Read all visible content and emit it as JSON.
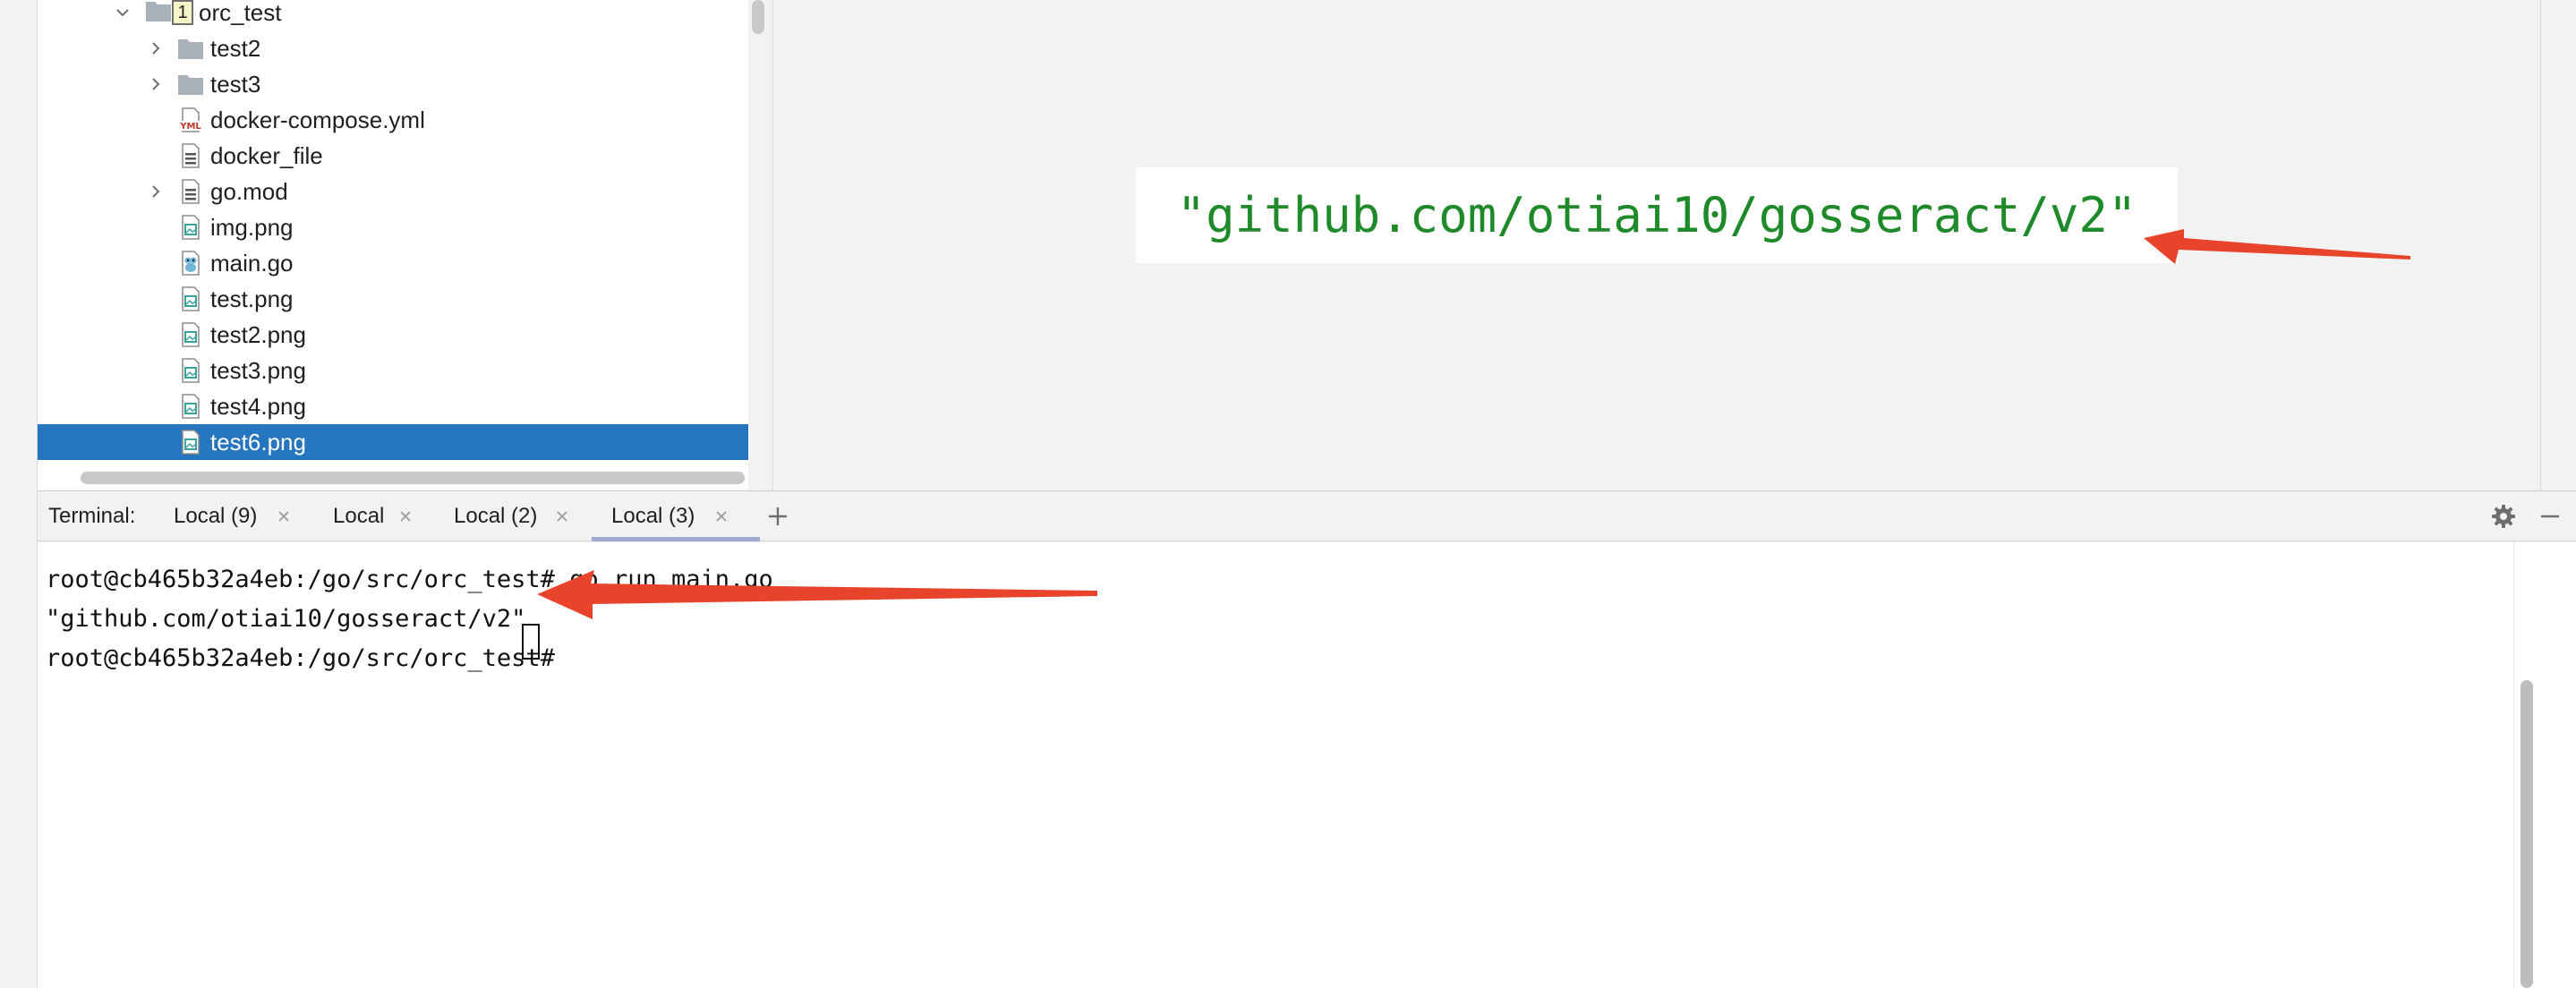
{
  "project_tree": {
    "root": {
      "label": "orc_test",
      "badge": "1"
    },
    "items": [
      {
        "label": "test2",
        "type": "folder",
        "expandable": true
      },
      {
        "label": "test3",
        "type": "folder",
        "expandable": true
      },
      {
        "label": "docker-compose.yml",
        "type": "yml",
        "badge": "YML"
      },
      {
        "label": "docker_file",
        "type": "text"
      },
      {
        "label": "go.mod",
        "type": "text",
        "expandable": true
      },
      {
        "label": "img.png",
        "type": "image"
      },
      {
        "label": "main.go",
        "type": "go"
      },
      {
        "label": "test.png",
        "type": "image"
      },
      {
        "label": "test2.png",
        "type": "image"
      },
      {
        "label": "test3.png",
        "type": "image"
      },
      {
        "label": "test4.png",
        "type": "image"
      },
      {
        "label": "test6.png",
        "type": "image",
        "selected": true
      }
    ]
  },
  "preview": {
    "code_text": "\"github.com/otiai10/gosseract/v2\"",
    "code_color": "#1f8a2a"
  },
  "terminal": {
    "caption": "Terminal:",
    "tabs": [
      {
        "label": "Local (9)",
        "active": false
      },
      {
        "label": "Local",
        "active": false
      },
      {
        "label": "Local (2)",
        "active": false
      },
      {
        "label": "Local (3)",
        "active": true
      }
    ],
    "add_tab_icon": "plus-icon",
    "settings_icon": "gear-icon",
    "minimize_icon": "minimize-icon",
    "lines": [
      "root@cb465b32a4eb:/go/src/orc_test# go run main.go",
      "\"github.com/otiai10/gosseract/v2\"",
      "root@cb465b32a4eb:/go/src/orc_test# "
    ]
  },
  "colors": {
    "selection": "#2675bf",
    "annotation_arrow": "#e8432b",
    "folder": "#a8b0ba"
  }
}
